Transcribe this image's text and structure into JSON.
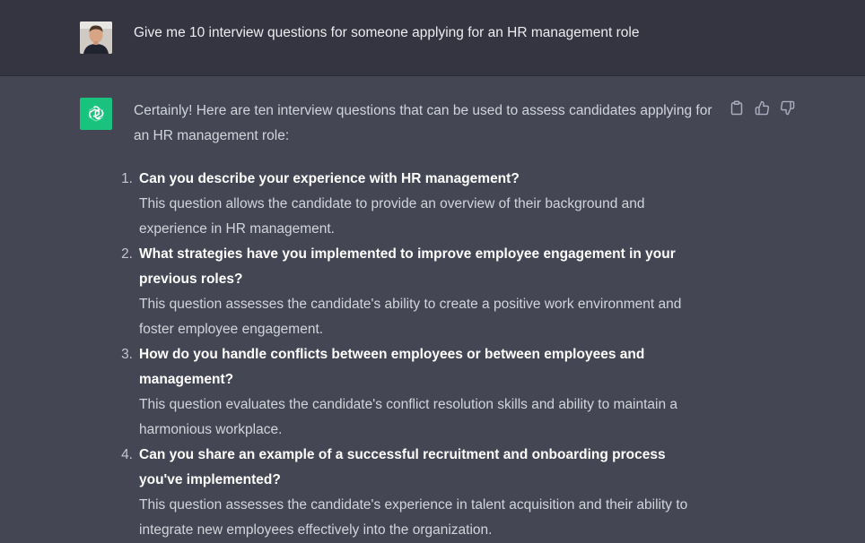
{
  "user_message": {
    "text": "Give me 10 interview questions for someone applying for an HR management role"
  },
  "assistant_message": {
    "intro": "Certainly! Here are ten interview questions that can be used to assess candidates applying for an HR management role:",
    "questions": [
      {
        "number": "1.",
        "question": "Can you describe your experience with HR management?",
        "description": "This question allows the candidate to provide an overview of their background and experience in HR management."
      },
      {
        "number": "2.",
        "question": "What strategies have you implemented to improve employee engagement in your previous roles?",
        "description": "This question assesses the candidate's ability to create a positive work environment and foster employee engagement."
      },
      {
        "number": "3.",
        "question": "How do you handle conflicts between employees or between employees and management?",
        "description": "This question evaluates the candidate's conflict resolution skills and ability to maintain a harmonious workplace."
      },
      {
        "number": "4.",
        "question": "Can you share an example of a successful recruitment and onboarding process you've implemented?",
        "description": "This question assesses the candidate's experience in talent acquisition and their ability to integrate new employees effectively into the organization."
      }
    ]
  },
  "icons": {
    "copy": "clipboard-icon",
    "thumbs_up": "thumbs-up-icon",
    "thumbs_down": "thumbs-down-icon",
    "assistant_logo": "openai-logo-icon"
  },
  "colors": {
    "user_bg": "#343541",
    "assistant_bg": "#444654",
    "bot_avatar": "#19c37d"
  }
}
